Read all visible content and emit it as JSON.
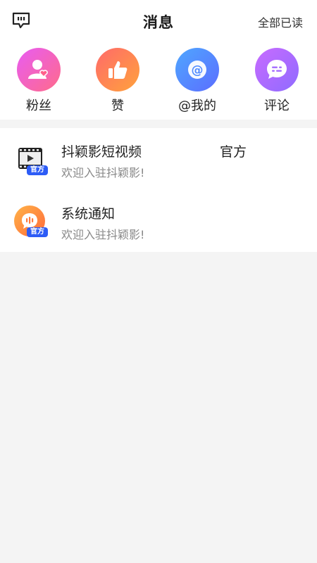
{
  "header": {
    "title": "消息",
    "mark_all_read": "全部已读",
    "chat_icon": "chat-bubble-icon"
  },
  "categories": [
    {
      "label": "粉丝",
      "icon": "fans-icon",
      "color": "#ff5f8a"
    },
    {
      "label": "赞",
      "icon": "thumbs-up-icon",
      "color": "#ff7a45"
    },
    {
      "label": "@我的",
      "icon": "at-icon",
      "color": "#4f8bff"
    },
    {
      "label": "评论",
      "icon": "comment-icon",
      "color": "#a36bff"
    }
  ],
  "messages": [
    {
      "name": "抖颖影短视频",
      "tag": "官方",
      "preview": "欢迎入驻抖颖影!",
      "badge": "官方",
      "icon": "film-icon"
    },
    {
      "name": "系统通知",
      "preview": "欢迎入驻抖颖影!",
      "badge": "官方",
      "icon": "system-notice-icon"
    }
  ]
}
